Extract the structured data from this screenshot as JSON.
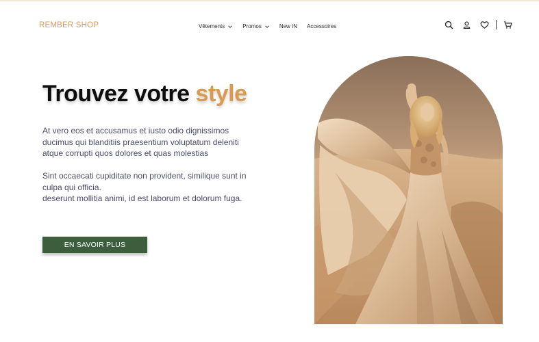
{
  "header": {
    "logo": "REMBER SHOP",
    "nav": [
      {
        "label": "Vêtements",
        "dropdown": true
      },
      {
        "label": "Promos",
        "dropdown": true
      },
      {
        "label": "New IN",
        "dropdown": false
      },
      {
        "label": "Accessoires",
        "dropdown": false
      }
    ],
    "icons": [
      "search-icon",
      "user-icon",
      "heart-icon",
      "cart-icon"
    ]
  },
  "hero": {
    "title_main": "Trouvez votre",
    "title_accent": "style",
    "paragraph1": "At vero eos et accusamus et iusto odio dignissimos ducimus qui blanditiis praesentium voluptatum deleniti atque corrupti quos dolores et quas molestias",
    "paragraph2": "Sint occaecati cupiditate non provident, similique sunt in culpa qui officia.\n deserunt mollitia animi, id est laborum et dolorum fuga.",
    "cta_label": "EN SAVOIR PLUS"
  },
  "colors": {
    "accent": "#d99a52",
    "button": "#3d5e3d",
    "text_body": "#4a4a6a"
  }
}
